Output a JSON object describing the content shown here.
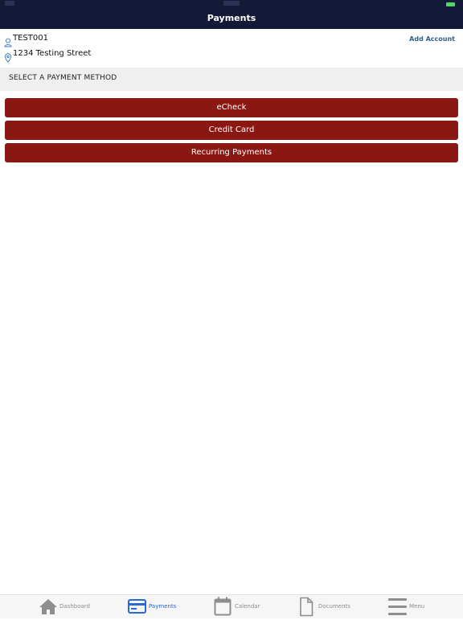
{
  "header": {
    "title": "Payments"
  },
  "account": {
    "id": "TEST001",
    "address": "1234 Testing Street",
    "add_account_label": "Add Account"
  },
  "section": {
    "title": "SELECT A PAYMENT METHOD"
  },
  "payment_methods": [
    {
      "label": "eCheck"
    },
    {
      "label": "Credit Card"
    },
    {
      "label": "Recurring Payments"
    }
  ],
  "tabs": [
    {
      "label": "Dashboard",
      "icon": "house-icon",
      "active": false
    },
    {
      "label": "Payments",
      "icon": "credit-card-icon",
      "active": true
    },
    {
      "label": "Calendar",
      "icon": "calendar-icon",
      "active": false
    },
    {
      "label": "Documents",
      "icon": "document-icon",
      "active": false
    },
    {
      "label": "Menu",
      "icon": "hamburger-menu-icon",
      "active": false
    }
  ],
  "colors": {
    "header_bg": "#131a38",
    "button_bg": "#8b1712",
    "link": "#2c5f8d",
    "tab_active": "#2a6ad0",
    "tab_inactive": "#8e8e8e",
    "battery": "#4cd964"
  }
}
